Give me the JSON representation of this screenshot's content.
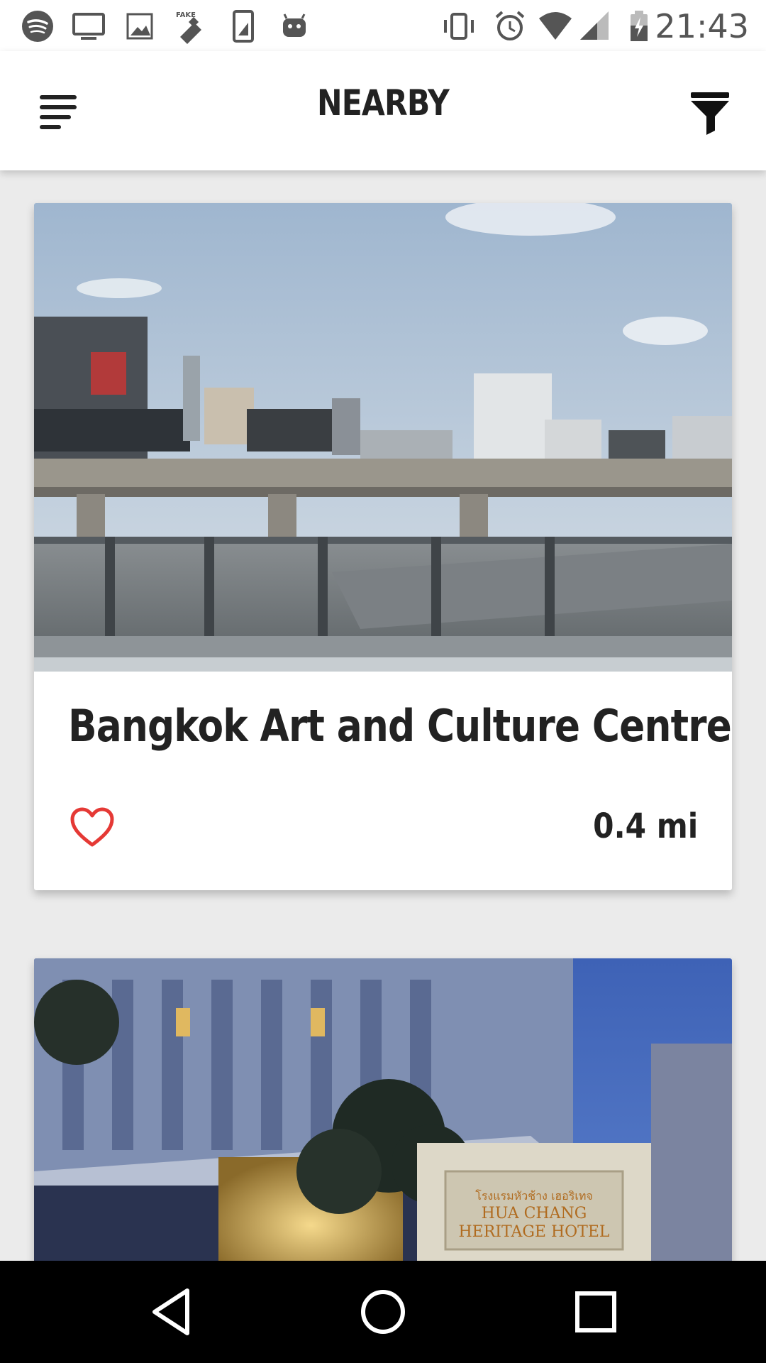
{
  "status_bar": {
    "time": "21:43",
    "left_icons": [
      "spotify-icon",
      "cast-screen-icon",
      "image-icon",
      "fake-gps-icon",
      "sim-card-icon",
      "android-icon"
    ],
    "right_icons": [
      "vibrate-icon",
      "alarm-icon",
      "wifi-icon",
      "signal-icon",
      "battery-charging-icon"
    ]
  },
  "app_bar": {
    "title": "NEARBY",
    "left_icon": "menu-icon",
    "right_icon": "filter-icon"
  },
  "places": [
    {
      "title": "Bangkok Art and Culture Centre",
      "distance": "0.4 mi",
      "favorite_icon": "heart-outline-icon",
      "image": "city-skytrain-photo"
    },
    {
      "title": "",
      "distance": "",
      "image": "hotel-photo",
      "sign_text": [
        "โรงแรมหัวช้าง เฮอริเทจ",
        "HUA CHANG",
        "HERITAGE HOTEL"
      ]
    }
  ],
  "nav_bar": {
    "icons": [
      "back-icon",
      "home-icon",
      "recents-icon"
    ]
  },
  "colors": {
    "heart": "#e53935",
    "background": "#ebebeb",
    "text": "#222222"
  }
}
